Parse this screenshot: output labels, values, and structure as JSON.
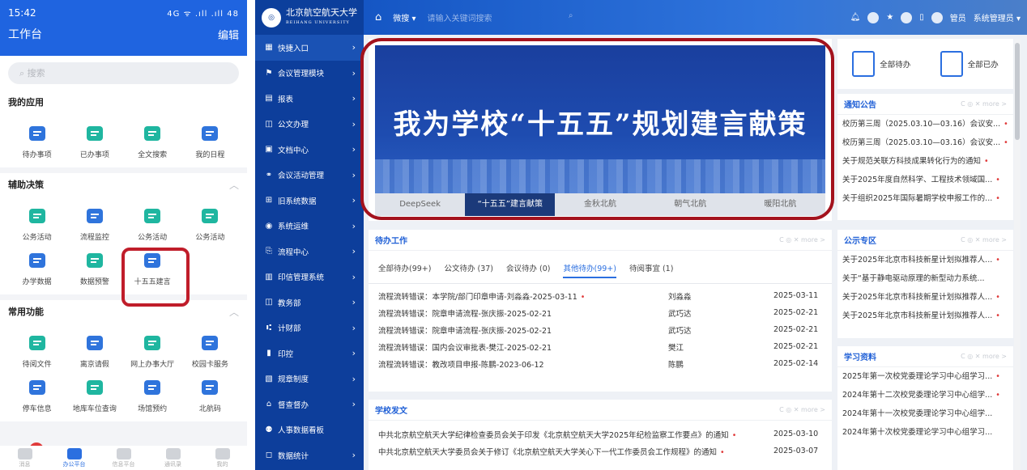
{
  "mobile": {
    "status": {
      "time": "15:42",
      "right": "4G ᯤ .ıll .ıll 48"
    },
    "header": {
      "title": "工作台",
      "edit": "编辑"
    },
    "search": {
      "placeholder": "搜索"
    },
    "sections": [
      {
        "title": "我的应用",
        "apps": [
          {
            "label": "待办事项",
            "color": "#2f74dc"
          },
          {
            "label": "已办事项",
            "color": "#1fb6a0"
          },
          {
            "label": "全文搜索",
            "color": "#1fb6a0"
          },
          {
            "label": "我的日程",
            "color": "#2f74dc"
          }
        ]
      },
      {
        "title": "辅助决策",
        "apps": [
          {
            "label": "公务活动",
            "color": "#1fb6a0"
          },
          {
            "label": "流程监控",
            "color": "#2f74dc"
          },
          {
            "label": "公务活动",
            "color": "#1fb6a0"
          },
          {
            "label": "公务活动",
            "color": "#1fb6a0"
          },
          {
            "label": "办学数据",
            "color": "#2f74dc"
          },
          {
            "label": "数据预警",
            "color": "#1fb6a0"
          },
          {
            "label": "十五五建言",
            "color": "#2f74dc"
          }
        ]
      },
      {
        "title": "常用功能",
        "apps": [
          {
            "label": "待阅文件",
            "color": "#1fb6a0"
          },
          {
            "label": "离京请假",
            "color": "#2f74dc"
          },
          {
            "label": "网上办事大厅",
            "color": "#1fb6a0"
          },
          {
            "label": "校园卡服务",
            "color": "#2f74dc"
          },
          {
            "label": "停车信息",
            "color": "#2f74dc"
          },
          {
            "label": "地库车位查询",
            "color": "#1fb6a0"
          },
          {
            "label": "场馆预约",
            "color": "#2f74dc"
          },
          {
            "label": "北航码",
            "color": "#2f74dc"
          }
        ]
      }
    ],
    "tabbar": [
      {
        "label": "消息",
        "badge": "16"
      },
      {
        "label": "办公平台"
      },
      {
        "label": "信息平台"
      },
      {
        "label": "通讯录"
      },
      {
        "label": "我的"
      }
    ]
  },
  "desk": {
    "logo": {
      "name": "北京航空航天大学",
      "en": "BEIHANG UNIVERSITY"
    },
    "topbar": {
      "search_scope": "微搜 ▾",
      "placeholder": "请输入关键词搜索",
      "user_role": "管员",
      "user": "系统管理员 ▾"
    },
    "menu": [
      "快捷入口",
      "会议管理模块",
      "报表",
      "公文办理",
      "文档中心",
      "会议活动管理",
      "旧系统数据",
      "系统运维",
      "流程中心",
      "印信管理系统",
      "教务部",
      "计财部",
      "印控",
      "规章制度",
      "督查督办",
      "人事数据看板",
      "数据统计"
    ],
    "banner": {
      "title": "我为学校“十五五”规划建言献策",
      "tabs": [
        "DeepSeek",
        "“十五五”建言献策",
        "金秋北航",
        "朝气北航",
        "暖阳北航"
      ]
    },
    "quick": {
      "todo": "全部待办",
      "done": "全部已办"
    },
    "notice": {
      "title": "通知公告",
      "items": [
        "校历第三周（2025.03.10—03.16）会议安...",
        "校历第三周（2025.03.10—03.16）会议安...",
        "关于规范关联方科技成果转化行为的通知",
        "关于2025年度自然科学、工程技术领域国...",
        "关于组织2025年国际暑期学校申报工作的..."
      ]
    },
    "public": {
      "title": "公示专区",
      "items": [
        "关于2025年北京市科技新星计划拟推荐人...",
        "关于“基于静电驱动原理的新型动力系统...",
        "关于2025年北京市科技新星计划拟推荐人...",
        "关于2025年北京市科技新星计划拟推荐人..."
      ]
    },
    "study": {
      "title": "学习资料",
      "items": [
        "2025年第一次校党委理论学习中心组学习...",
        "2024年第十二次校党委理论学习中心组学...",
        "2024年第十一次校党委理论学习中心组学...",
        "2024年第十次校党委理论学习中心组学习..."
      ]
    },
    "todo": {
      "title": "待办工作",
      "tabs": [
        "全部待办(99+)",
        "公文待办 (37)",
        "会议待办 (0)",
        "其他待办(99+)",
        "待阅事宜 (1)"
      ],
      "rows": [
        [
          "流程流转错误：本学院/部门印章申请-刘淼淼-2025-03-11",
          "刘淼淼",
          "2025-03-11"
        ],
        [
          "流程流转错误：院章申请流程-张庆振-2025-02-21",
          "武巧达",
          "2025-02-21"
        ],
        [
          "流程流转错误：院章申请流程-张庆振-2025-02-21",
          "武巧达",
          "2025-02-21"
        ],
        [
          "流程流转错误：国内会议审批表-樊江-2025-02-21",
          "樊江",
          "2025-02-21"
        ],
        [
          "流程流转错误：教改项目申报-陈鹏-2023-06-12",
          "陈鹏",
          "2025-02-14"
        ]
      ]
    },
    "news": {
      "title": "学校发文",
      "rows": [
        [
          "中共北京航空航天大学纪律检查委员会关于印发《北京航空航天大学2025年纪检监察工作要点》的通知",
          "2025-03-10"
        ],
        [
          "中共北京航空航天大学委员会关于修订《北京航空航天大学关心下一代工作委员会工作规程》的通知",
          "2025-03-07"
        ]
      ]
    },
    "more": "C ◎ ✕ more >"
  }
}
